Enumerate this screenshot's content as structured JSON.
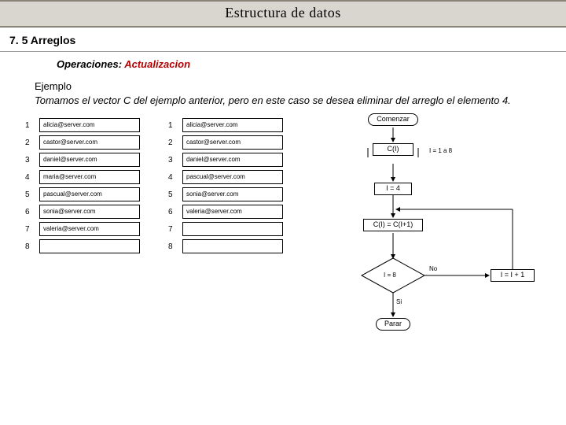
{
  "header": {
    "title": "Estructura  de datos"
  },
  "section": {
    "number_label": "7. 5 Arreglos",
    "operations_label": "Operaciones:  ",
    "operations_highlight": "Actualizacion"
  },
  "example": {
    "heading": "Ejemplo",
    "body": "Tomamos el vector  C del ejemplo anterior,  pero en este caso se desea eliminar del arreglo el elemento 4."
  },
  "array_before": {
    "indices": [
      "1",
      "2",
      "3",
      "4",
      "5",
      "6",
      "7",
      "8"
    ],
    "values": [
      "alicia@server.com",
      "castor@server.com",
      "daniel@server.com",
      "maria@server.com",
      "pascual@server.com",
      "sonia@server.com",
      "valeria@server.com",
      ""
    ]
  },
  "array_after": {
    "indices": [
      "1",
      "2",
      "3",
      "4",
      "5",
      "6",
      "7",
      "8"
    ],
    "values": [
      "alicia@server.com",
      "castor@server.com",
      "daniel@server.com",
      "pascual@server.com",
      "sonia@server.com",
      "valeria@server.com",
      "",
      ""
    ]
  },
  "flowchart": {
    "start": "Comenzar",
    "read": "C(I)",
    "read_note": "I = 1 a 8",
    "init": "I = 4",
    "shift": "C(I) = C(I+1)",
    "decision": "I = 8",
    "yes": "Si",
    "no": "No",
    "increment": "I = I + 1",
    "stop": "Parar"
  }
}
